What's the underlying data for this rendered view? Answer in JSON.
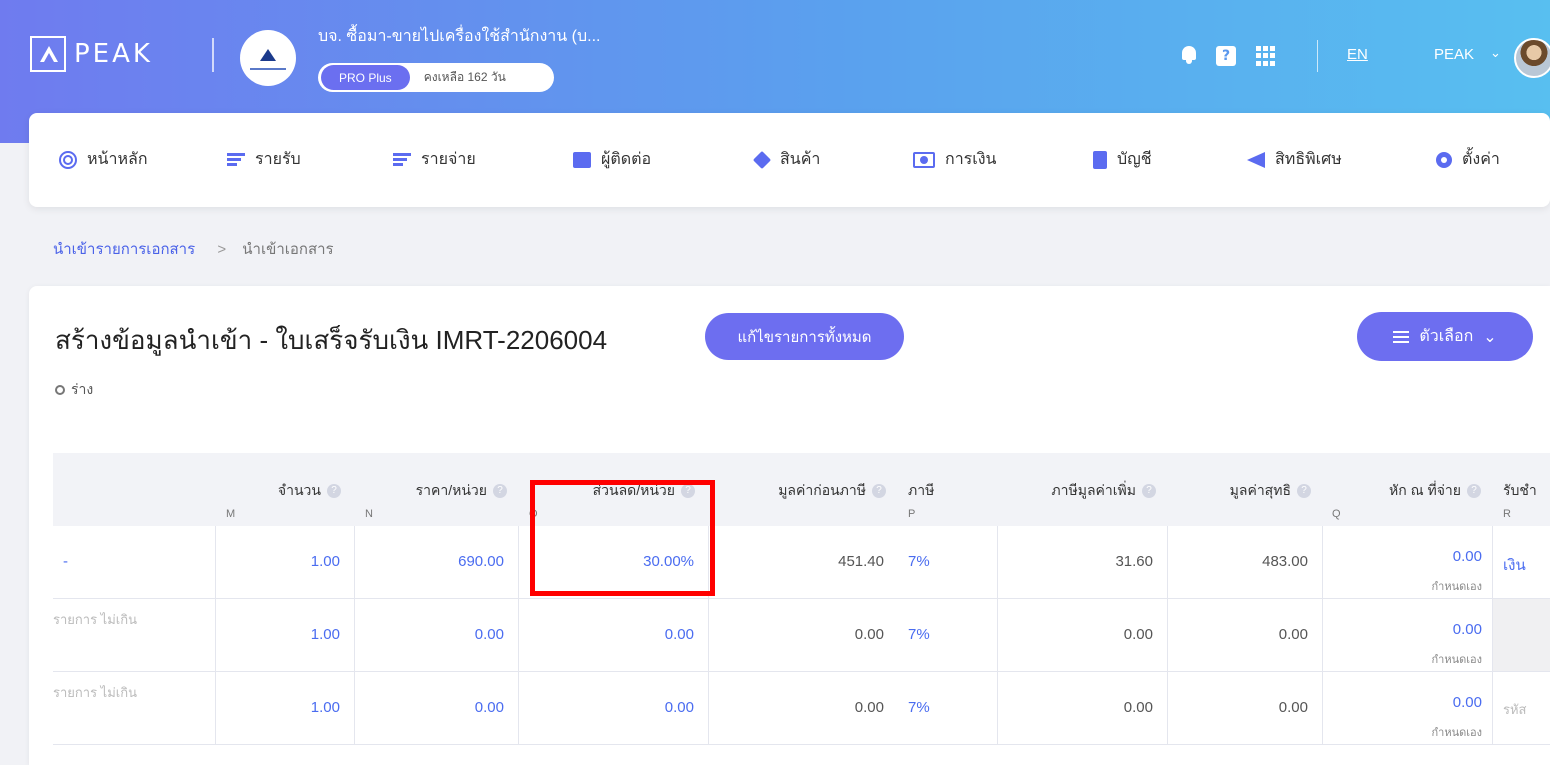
{
  "header": {
    "logo_text": "PEAK",
    "company_name": "บจ. ซื้อมา-ขายไปเครื่องใช้สำนักงาน (บ...",
    "plan": "PRO Plus",
    "days_left": "คงเหลือ 162 วัน",
    "help_glyph": "?",
    "language": "EN",
    "user_name": "PEAK",
    "user_chevron": "⌄"
  },
  "nav": {
    "items": [
      {
        "label": "หน้าหลัก",
        "icon": "home-icon"
      },
      {
        "label": "รายรับ",
        "icon": "sort-icon"
      },
      {
        "label": "รายจ่าย",
        "icon": "sort-icon"
      },
      {
        "label": "ผู้ติดต่อ",
        "icon": "contact-icon"
      },
      {
        "label": "สินค้า",
        "icon": "box-icon"
      },
      {
        "label": "การเงิน",
        "icon": "money-icon"
      },
      {
        "label": "บัญชี",
        "icon": "book-icon"
      },
      {
        "label": "สิทธิพิเศษ",
        "icon": "megaphone-icon"
      },
      {
        "label": "ตั้งค่า",
        "icon": "gear-icon"
      }
    ]
  },
  "breadcrumb": {
    "link": "นำเข้ารายการเอกสาร",
    "separator": ">",
    "current": "นำเข้าเอกสาร"
  },
  "page": {
    "title": "สร้างข้อมูลนำเข้า - ใบเสร็จรับเงิน IMRT-2206004",
    "edit_all_button": "แก้ไขรายการทั้งหมด",
    "options_button": "ตัวเลือก",
    "options_chevron": "⌄",
    "status": "ร่าง"
  },
  "table": {
    "help_glyph": "?",
    "headers": [
      {
        "label": "จำนวน",
        "col": "M"
      },
      {
        "label": "ราคา/หน่วย",
        "col": "N"
      },
      {
        "label": "ส่วนลด/หน่วย",
        "col": "O"
      },
      {
        "label": "มูลค่าก่อนภาษี",
        "col": ""
      },
      {
        "label": "ภาษี",
        "col": "P"
      },
      {
        "label": "ภาษีมูลค่าเพิ่ม",
        "col": ""
      },
      {
        "label": "มูลค่าสุทธิ",
        "col": ""
      },
      {
        "label": "หัก ณ ที่จ่าย",
        "col": "Q"
      },
      {
        "label": "รับชำ",
        "col": "R"
      }
    ],
    "rows": [
      {
        "first": "-",
        "qty": "1.00",
        "price": "690.00",
        "discount": "30.00%",
        "pretax": "451.40",
        "tax": "7%",
        "vat": "31.60",
        "net": "483.00",
        "wht": "0.00",
        "wht_sub": "กำหนดเอง",
        "pay": "เงิน"
      },
      {
        "first": "รายการ ไม่เกิน",
        "qty": "1.00",
        "price": "0.00",
        "discount": "0.00",
        "pretax": "0.00",
        "tax": "7%",
        "vat": "0.00",
        "net": "0.00",
        "wht": "0.00",
        "wht_sub": "กำหนดเอง",
        "pay": ""
      },
      {
        "first": "รายการ ไม่เกิน",
        "qty": "1.00",
        "price": "0.00",
        "discount": "0.00",
        "pretax": "0.00",
        "tax": "7%",
        "vat": "0.00",
        "net": "0.00",
        "wht": "0.00",
        "wht_sub": "กำหนดเอง",
        "pay": "รหัส"
      }
    ]
  }
}
